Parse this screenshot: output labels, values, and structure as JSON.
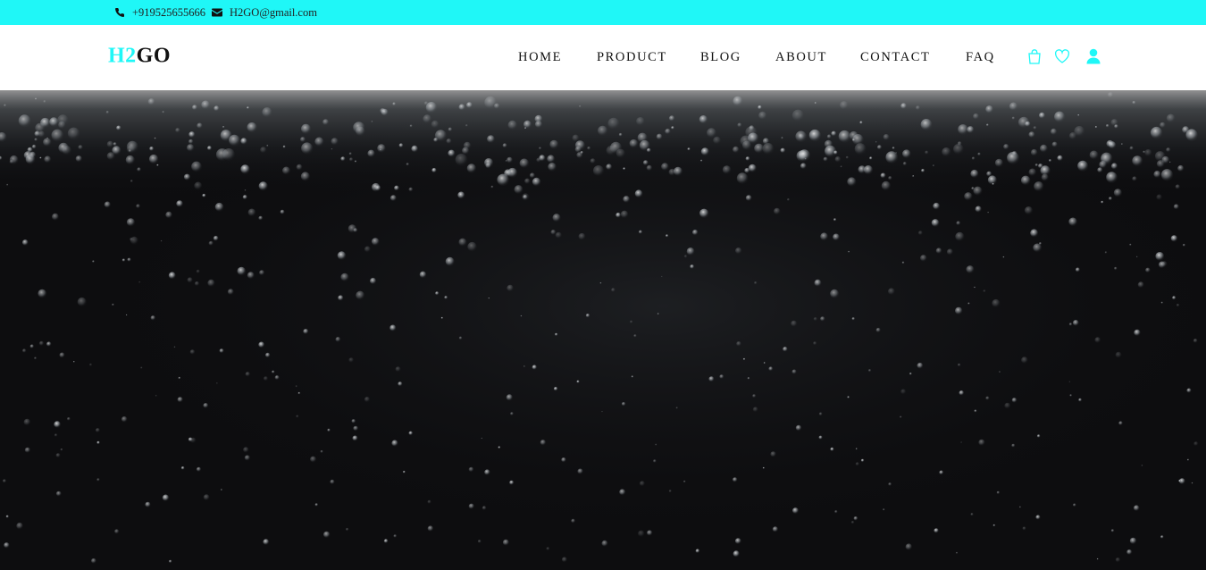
{
  "topbar": {
    "phone": "+919525655666",
    "email": "H2GO@gmail.com",
    "phone_icon": "phone-icon",
    "email_icon": "envelope-icon",
    "background": "#1ff7f7"
  },
  "header": {
    "logo_part1": "H2",
    "logo_part2": "GO",
    "nav": [
      {
        "label": "HOME"
      },
      {
        "label": "PRODUCT"
      },
      {
        "label": "BLOG"
      },
      {
        "label": "ABOUT"
      },
      {
        "label": "CONTACT"
      },
      {
        "label": "FAQ"
      }
    ],
    "icons": [
      "shopping-bag-icon",
      "heart-icon",
      "user-icon"
    ],
    "accent": "#1ff7f7"
  },
  "hero": {
    "image": "underwater-bubbles-photo",
    "background": "#0d0d0f"
  }
}
